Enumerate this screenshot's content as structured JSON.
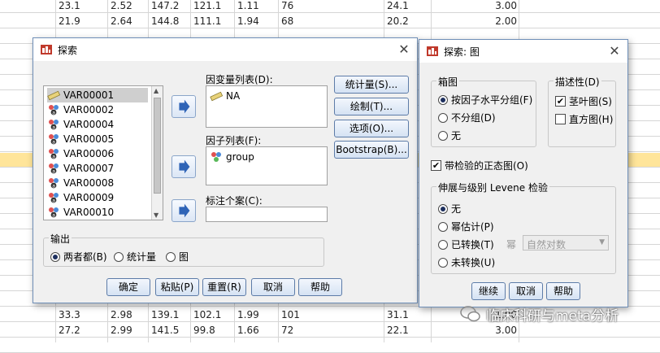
{
  "sheet": {
    "rows": [
      [
        "23.1",
        "2.52",
        "147.2",
        "121.1",
        "1.11",
        "76",
        "24.1",
        "3.00"
      ],
      [
        "21.9",
        "2.64",
        "144.8",
        "111.1",
        "1.94",
        "68",
        "20.2",
        "2.00"
      ],
      [
        "",
        "",
        "",
        "",
        "",
        "",
        "",
        ""
      ],
      [
        "",
        "",
        "",
        "",
        "",
        "",
        "",
        ""
      ],
      [
        "",
        "",
        "",
        "",
        "",
        "",
        "",
        ""
      ],
      [
        "",
        "",
        "",
        "",
        "",
        "",
        "",
        ""
      ],
      [
        "",
        "",
        "",
        "",
        "",
        "",
        "",
        ""
      ],
      [
        "",
        "",
        "",
        "",
        "",
        "",
        "",
        ""
      ],
      [
        "",
        "",
        "",
        "",
        "",
        "",
        "",
        ""
      ],
      [
        "",
        "",
        "",
        "",
        "",
        "",
        "",
        ""
      ],
      [
        "",
        "",
        "",
        "",
        "",
        "",
        "",
        ""
      ],
      [
        "",
        "",
        "",
        "",
        "",
        "",
        "",
        ""
      ],
      [
        "",
        "",
        "",
        "",
        "",
        "",
        "",
        ""
      ],
      [
        "",
        "",
        "",
        "",
        "",
        "",
        "",
        ""
      ],
      [
        "",
        "",
        "",
        "",
        "",
        "",
        "",
        ""
      ],
      [
        "",
        "",
        "",
        "",
        "",
        "",
        "",
        ""
      ],
      [
        "",
        "",
        "",
        "",
        "",
        "",
        "",
        ""
      ],
      [
        "",
        "",
        "",
        "",
        "",
        "",
        "",
        ""
      ],
      [
        "",
        "",
        "",
        "",
        "",
        "",
        "",
        ""
      ],
      [
        "",
        "",
        "",
        "",
        "",
        "",
        "",
        ""
      ],
      [
        "33.3",
        "2.98",
        "139.1",
        "102.1",
        "1.99",
        "101",
        "31.1",
        "1.00"
      ],
      [
        "27.2",
        "2.99",
        "141.5",
        "99.8",
        "1.66",
        "72",
        "22.1",
        "3.00"
      ],
      [
        "",
        "",
        "",
        "",
        "",
        "",
        "",
        ""
      ]
    ]
  },
  "explore": {
    "title": "探索",
    "variables": [
      "VAR00001",
      "VAR00002",
      "VAR00004",
      "VAR00005",
      "VAR00006",
      "VAR00007",
      "VAR00008",
      "VAR00009",
      "VAR00010"
    ],
    "dependent_label": "因变量列表(D):",
    "dependent_value": "NA",
    "factor_label": "因子列表(F):",
    "factor_value": "group",
    "label_cases_label": "标注个案(C):",
    "buttons": [
      "统计量(S)...",
      "绘制(T)...",
      "选项(O)...",
      "Bootstrap(B)..."
    ],
    "output_title": "输出",
    "output_options": [
      "两者都(B)",
      "统计量",
      "图"
    ],
    "bottom_buttons": [
      "确定",
      "粘贴(P)",
      "重置(R)",
      "取消",
      "帮助"
    ]
  },
  "plots": {
    "title": "探索: 图",
    "boxplot_title": "箱图",
    "boxplot_options": [
      "按因子水平分组(F)",
      "不分组(D)",
      "无"
    ],
    "descriptive_title": "描述性(D)",
    "descriptive_options": [
      "茎叶图(S)",
      "直方图(H)"
    ],
    "normality_label": "带检验的正态图(O)",
    "levene_title": "伸展与级别 Levene 检验",
    "levene_options": [
      "无",
      "幂估计(P)",
      "已转换(T)",
      "未转换(U)"
    ],
    "power_label": "幂",
    "power_value": "自然对数",
    "buttons": [
      "继续",
      "取消",
      "帮助"
    ]
  },
  "watermark": "临床科研与meta分析"
}
